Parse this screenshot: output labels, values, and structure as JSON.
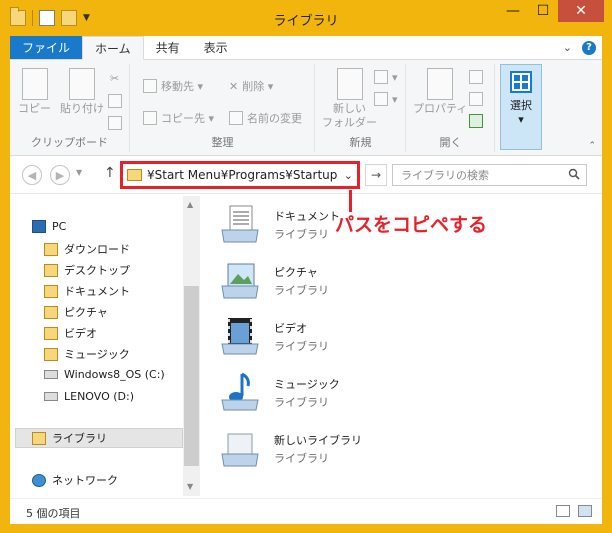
{
  "window": {
    "title": "ライブラリ",
    "minimize": "—",
    "maximize": "☐",
    "close": "✕"
  },
  "ribbon_tabs": {
    "file": "ファイル",
    "home": "ホーム",
    "share": "共有",
    "view": "表示"
  },
  "ribbon": {
    "copy": "コピー",
    "paste": "貼り付け",
    "clipboard_group": "クリップボード",
    "move_to": "移動先 ▾",
    "copy_to": "コピー先 ▾",
    "delete": "削除 ▾",
    "rename": "名前の変更",
    "organize_group": "整理",
    "new_folder_line1": "新しい",
    "new_folder_line2": "フォルダー",
    "new_group": "新規",
    "properties": "プロパティ",
    "open_group": "開く",
    "select": "選択",
    "select_arrow": "▾"
  },
  "nav": {
    "back": "◀",
    "forward": "▶",
    "up": "↑",
    "address": "¥Start Menu¥Programs¥Startup",
    "address_chevron": "⌄",
    "go": "→",
    "search_placeholder": "ライブラリの検索"
  },
  "annotation": {
    "callout": "パスをコピペする"
  },
  "nav_pane": {
    "items": [
      {
        "label": "PC"
      },
      {
        "label": "ダウンロード"
      },
      {
        "label": "デスクトップ"
      },
      {
        "label": "ドキュメント"
      },
      {
        "label": "ピクチャ"
      },
      {
        "label": "ビデオ"
      },
      {
        "label": "ミュージック"
      },
      {
        "label": "Windows8_OS (C:)"
      },
      {
        "label": "LENOVO (D:)"
      },
      {
        "label": "ライブラリ"
      },
      {
        "label": "ネットワーク"
      }
    ]
  },
  "files": [
    {
      "name": "ドキュメント",
      "type": "ライブラリ",
      "icon": "documents-library-icon"
    },
    {
      "name": "ピクチャ",
      "type": "ライブラリ",
      "icon": "pictures-library-icon"
    },
    {
      "name": "ビデオ",
      "type": "ライブラリ",
      "icon": "videos-library-icon"
    },
    {
      "name": "ミュージック",
      "type": "ライブラリ",
      "icon": "music-library-icon"
    },
    {
      "name": "新しいライブラリ",
      "type": "ライブラリ",
      "icon": "new-library-icon"
    }
  ],
  "status": {
    "count": "5 個の項目"
  },
  "colors": {
    "title_bar": "#f1b50e",
    "file_tab": "#1979ca",
    "highlight_red": "#e6212a",
    "close_button": "#c7503c"
  }
}
